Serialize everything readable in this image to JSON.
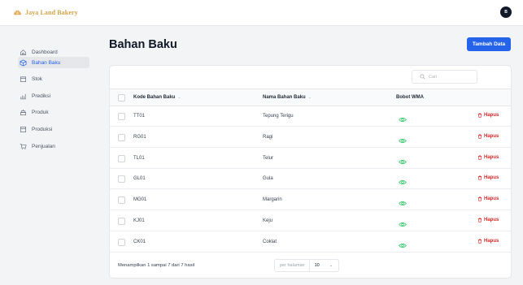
{
  "brand": {
    "name": "Jaya Land Bakery",
    "logo_icon": "bakery-logo-icon"
  },
  "user": {
    "avatar_initial": "B"
  },
  "sidebar": {
    "items": [
      {
        "label": "Dashboard",
        "icon": "home-icon",
        "active": false
      },
      {
        "label": "Bahan Baku",
        "icon": "cube-icon",
        "active": true
      },
      {
        "label": "Stok",
        "icon": "box-icon",
        "active": false
      },
      {
        "label": "Prediksi",
        "icon": "chart-icon",
        "active": false
      },
      {
        "label": "Produk",
        "icon": "cake-icon",
        "active": false
      },
      {
        "label": "Produksi",
        "icon": "archive-icon",
        "active": false
      },
      {
        "label": "Penjualan",
        "icon": "cart-icon",
        "active": false
      }
    ]
  },
  "page": {
    "title": "Bahan Baku",
    "add_label": "Tambah Data"
  },
  "search": {
    "placeholder": "Cari"
  },
  "table": {
    "headers": {
      "code": "Kode Bahan Baku",
      "name": "Nama Bahan Baku",
      "wma": "Bobot WMA"
    },
    "delete_label": "Hapus",
    "rows": [
      {
        "code": "TT01",
        "name": "Tepung Terigu"
      },
      {
        "code": "RG01",
        "name": "Ragi"
      },
      {
        "code": "TL01",
        "name": "Telur"
      },
      {
        "code": "GL01",
        "name": "Gula"
      },
      {
        "code": "MG01",
        "name": "Margarin"
      },
      {
        "code": "KJ01",
        "name": "Keju"
      },
      {
        "code": "CK01",
        "name": "Coklat"
      }
    ]
  },
  "footer": {
    "summary": "Menampilkan 1 sampai 7 dari 7 hasil",
    "per_page_label": "per halaman",
    "per_page_value": "10"
  },
  "colors": {
    "primary": "#2563eb",
    "danger": "#dc2626",
    "success": "#22c55e",
    "brand": "#d4a44a"
  }
}
